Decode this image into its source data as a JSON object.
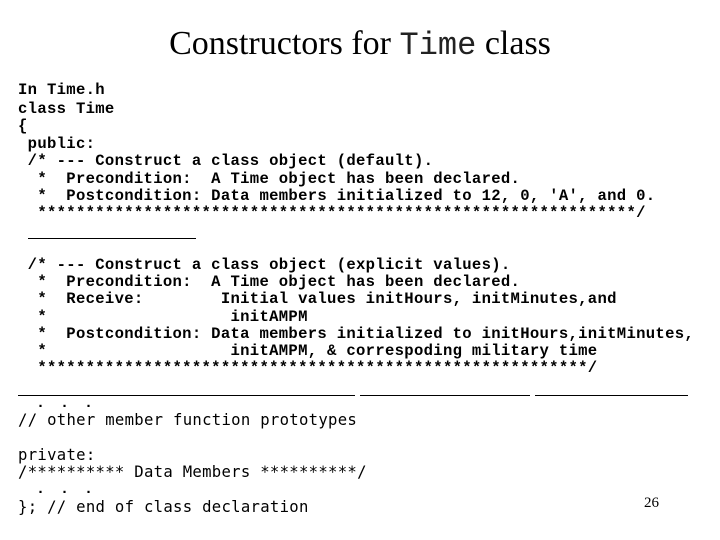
{
  "slide": {
    "title_prefix": "Constructors for ",
    "title_code": "Time",
    "title_suffix": " class",
    "page_number": "26"
  },
  "code": {
    "file_label": "In Time.h",
    "lines_top": [
      "class Time",
      "{",
      " public:",
      " /* --- Construct a class object (default).",
      "  *  Precondition:  A Time object has been declared.",
      "  *  Postcondition: Data members initialized to 12, 0, 'A', and 0.",
      "  **************************************************************/"
    ],
    "lines_mid": [
      " /* --- Construct a class object (explicit values).",
      "  *  Precondition:  A Time object has been declared.",
      "  *  Receive:        Initial values initHours, initMinutes,and",
      "  *                   initAMPM",
      "  *  Postcondition: Data members initialized to initHours,initMinutes,",
      "  *                   initAMPM, & correspoding military time",
      "  *********************************************************/"
    ],
    "ellipsis": ". . .",
    "other_prototypes_comment": "// other member function prototypes",
    "private_label": "private:",
    "data_members_comment": "/********** Data Members **********/",
    "end_line": "}; // end of class declaration"
  }
}
